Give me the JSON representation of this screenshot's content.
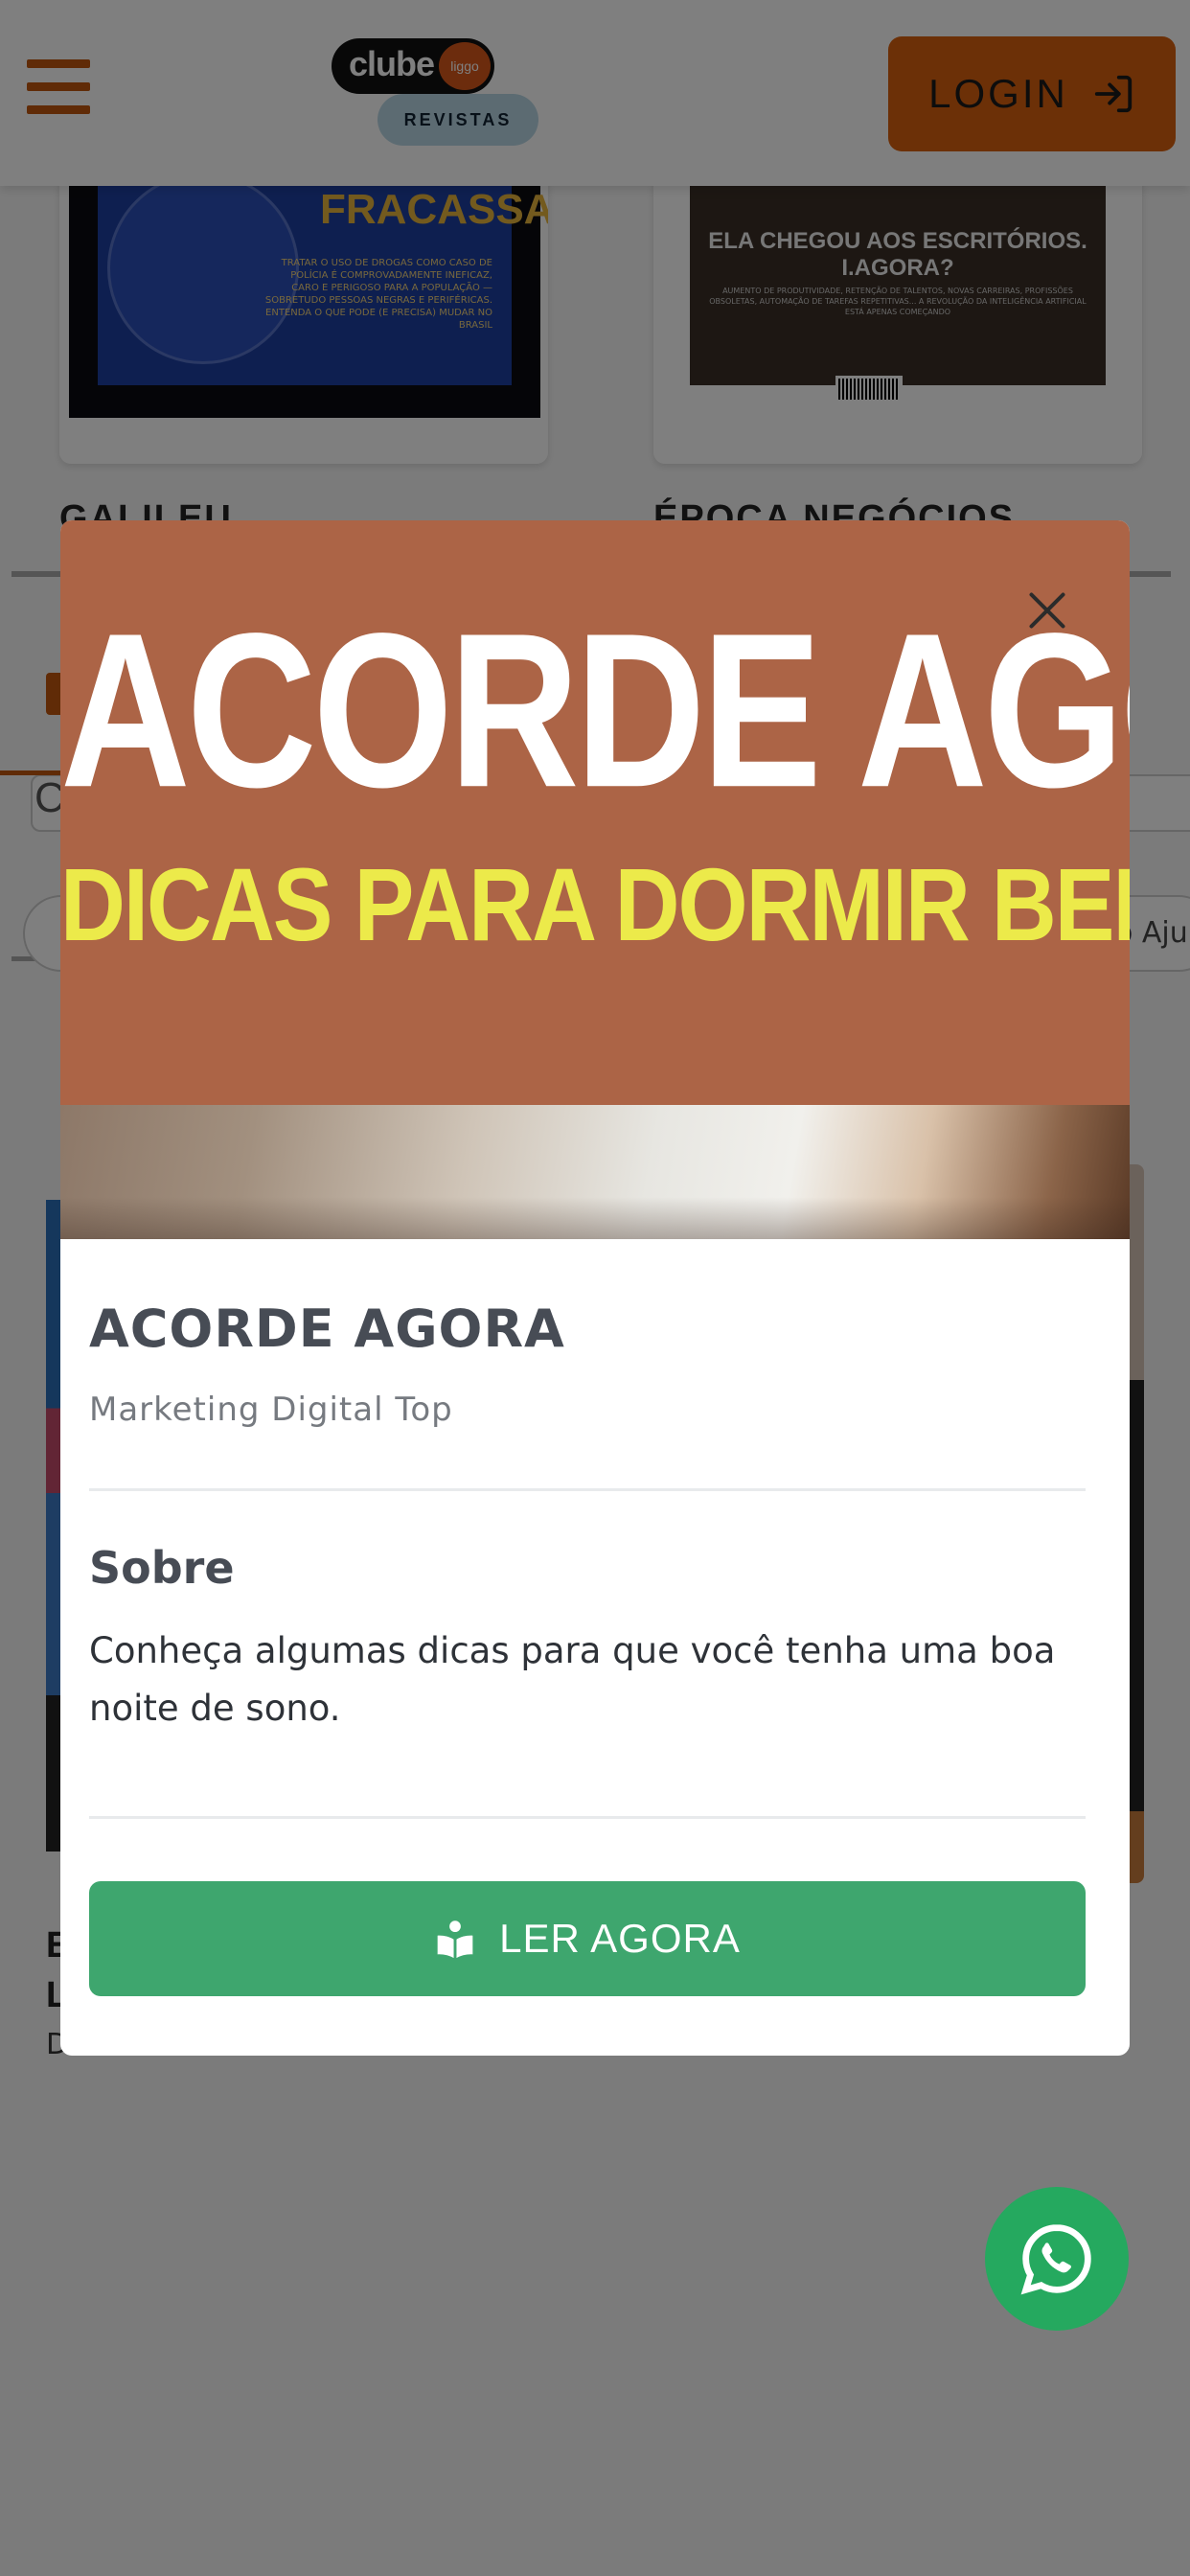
{
  "header": {
    "logo_word": "clube",
    "logo_badge": "liggo",
    "logo_sub": "REVISTAS",
    "login_label": "LOGIN"
  },
  "magazines": [
    {
      "name": "GALILEU",
      "cover_headline": "GUERRA FRACASSADA",
      "cover_text": "TRATAR O USO DE DROGAS COMO CASO DE POLÍCIA É COMPROVADAMENTE INEFICAZ, CARO E PERIGOSO PARA A POPULAÇÃO — SOBRETUDO PESSOAS NEGRAS E PERIFÉRICAS. ENTENDA O QUE PODE (E PRECISA) MUDAR NO BRASIL"
    },
    {
      "name": "ÉPOCA NEGÓCIOS",
      "cover_headline": "ELA CHEGOU AOS ESCRITÓRIOS. I.AGORA?",
      "cover_text": "AUMENTO DE PRODUTIVIDADE, RETENÇÃO DE TALENTOS, NOVAS CARREIRAS, PROFISSÕES OBSOLETAS, AUTOMAÇÃO DE TAREFAS REPETITIVAS... A REVOLUÇÃO DA INTELIGÊNCIA ARTIFICIAL ESTÁ APENAS COMEÇANDO"
    }
  ],
  "background": {
    "search_initial": "C",
    "chip_right_label": "o Aju",
    "book_title_line1": "E",
    "book_title_line2": "L",
    "book_author": "Desconhecido"
  },
  "modal": {
    "banner_title": "ACORDE AGORA",
    "banner_subtitle": "DICAS PARA DORMIR BEM",
    "title": "ACORDE AGORA",
    "subtitle": "Marketing Digital Top",
    "section_heading": "Sobre",
    "description": "Conheça algumas dicas para que você tenha uma boa noite de sono.",
    "read_button_label": "LER AGORA"
  },
  "colors": {
    "brand_orange": "#d9610f",
    "banner_bg": "#ac6446",
    "banner_subtitle": "#ecea4a",
    "read_button": "#3ea66e",
    "whatsapp": "#25a95f"
  },
  "icons": {
    "menu": "hamburger-icon",
    "login": "login-arrow-icon",
    "close": "close-icon",
    "read": "open-book-reader-icon",
    "whatsapp": "whatsapp-icon"
  }
}
